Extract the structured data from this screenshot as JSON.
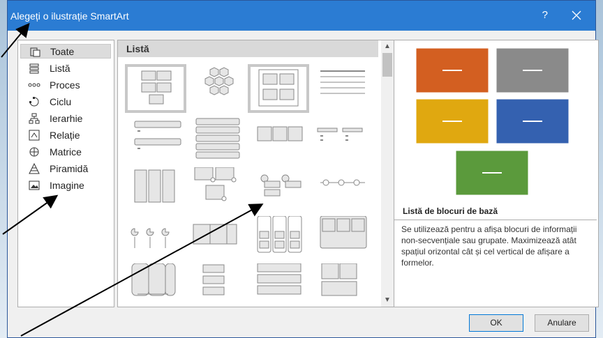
{
  "window": {
    "title": "Alegeți o ilustrație SmartArt",
    "help": "?",
    "close_icon": "close-icon"
  },
  "sidebar": {
    "items": [
      {
        "label": "Toate",
        "icon": "all-icon",
        "selected": true
      },
      {
        "label": "Listă",
        "icon": "list-icon"
      },
      {
        "label": "Proces",
        "icon": "process-icon"
      },
      {
        "label": "Ciclu",
        "icon": "cycle-icon"
      },
      {
        "label": "Ierarhie",
        "icon": "hierarchy-icon"
      },
      {
        "label": "Relație",
        "icon": "relationship-icon"
      },
      {
        "label": "Matrice",
        "icon": "matrix-icon"
      },
      {
        "label": "Piramidă",
        "icon": "pyramid-icon"
      },
      {
        "label": "Imagine",
        "icon": "picture-icon"
      }
    ]
  },
  "gallery": {
    "header": "Listă"
  },
  "preview": {
    "colors": [
      "#d35f21",
      "#8a8a8a",
      "#e0a810",
      "#3461b0",
      "#5b9a3c"
    ],
    "title": "Listă de blocuri de bază",
    "description": "Se utilizează pentru a afișa blocuri de informații non-secvențiale sau grupate. Maximizează atât spațiul orizontal cât și cel vertical de afișare a formelor."
  },
  "buttons": {
    "ok": "OK",
    "cancel": "Anulare"
  }
}
